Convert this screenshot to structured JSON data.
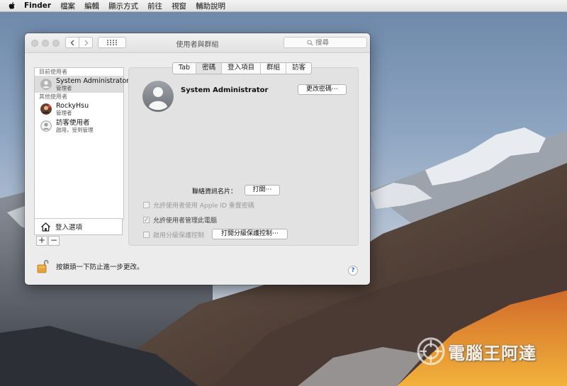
{
  "menubar": {
    "items": [
      {
        "label": "Finder",
        "bold": true
      },
      {
        "label": "檔案",
        "bold": false
      },
      {
        "label": "編輯",
        "bold": false
      },
      {
        "label": "顯示方式",
        "bold": false
      },
      {
        "label": "前往",
        "bold": false
      },
      {
        "label": "視窗",
        "bold": false
      },
      {
        "label": "輔助說明",
        "bold": false
      }
    ]
  },
  "window": {
    "title": "使用者與群組",
    "search_placeholder": "搜尋"
  },
  "sidebar": {
    "current_label": "目前使用者",
    "current_users": [
      {
        "name": "System Administrator",
        "role": "管理者"
      }
    ],
    "other_label": "其他使用者",
    "other_users": [
      {
        "name": "RockyHsu",
        "role": "管理者"
      },
      {
        "name": "訪客使用者",
        "role": "啟用，受到管理"
      }
    ],
    "login_options": "登入選項",
    "add": "+",
    "remove": "−"
  },
  "tabs": [
    {
      "label": "Tab",
      "active": false
    },
    {
      "label": "密碼",
      "active": true
    },
    {
      "label": "登入項目",
      "active": false
    },
    {
      "label": "群組",
      "active": false
    },
    {
      "label": "訪客",
      "active": false
    }
  ],
  "detail": {
    "user_name": "System Administrator",
    "change_password": "更改密碼⋯",
    "contact_card_label": "聯絡資訊名片：",
    "open_button": "打開⋯",
    "opt_reset_apple_id": "允許使用者使用 Apple ID 重置密碼",
    "opt_admin": "允許使用者管理此電腦",
    "opt_admin_checked": true,
    "opt_parental": "啟用分級保護控制",
    "open_parental": "打開分級保護控制⋯"
  },
  "footer": {
    "lock_text": "按鎖頭一下防止進一步更改。",
    "help": "?"
  },
  "watermark": "電腦王阿達"
}
